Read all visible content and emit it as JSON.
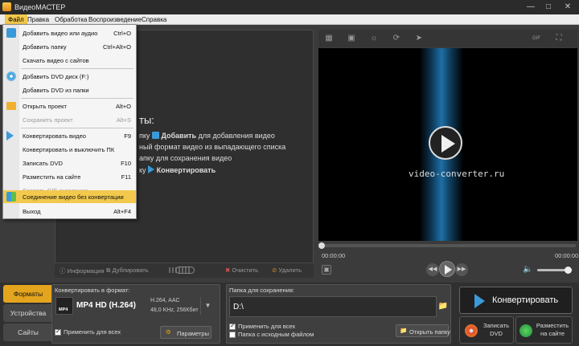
{
  "window": {
    "title": "ВидеоМАСТЕР"
  },
  "menubar": {
    "items": [
      "Файл",
      "Правка",
      "Обработка",
      "Воспроизведение",
      "Справка"
    ]
  },
  "file_menu": {
    "items": [
      {
        "label": "Добавить видео или аудио",
        "shortcut": "Ctrl+O",
        "icon": "add-video-icon"
      },
      {
        "label": "Добавить папку",
        "shortcut": "Ctrl+Alt+O"
      },
      {
        "label": "Скачать видео с сайтов",
        "shortcut": ""
      },
      {
        "label": "Добавить DVD диск (F:)",
        "shortcut": "",
        "icon": "dvd-icon"
      },
      {
        "label": "Добавить DVD из папки",
        "shortcut": ""
      },
      {
        "label": "Открыть проект",
        "shortcut": "Alt+O",
        "icon": "folder-icon"
      },
      {
        "label": "Сохранить проект",
        "shortcut": "Alt+S",
        "disabled": true
      },
      {
        "label": "Конвертировать видео",
        "shortcut": "F9",
        "icon": "play-icon"
      },
      {
        "label": "Конвертировать и выключить ПК",
        "shortcut": ""
      },
      {
        "label": "Записать DVD",
        "shortcut": "F10"
      },
      {
        "label": "Разместить на сайте",
        "shortcut": "F11"
      },
      {
        "label": "Создать GIF-анимацию",
        "shortcut": "",
        "disabled": true
      },
      {
        "label": "Соединение видео без конвертации",
        "shortcut": "",
        "icon": "join-icon",
        "highlighted": true
      },
      {
        "label": "Выход",
        "shortcut": "Alt+F4"
      }
    ]
  },
  "main_pane": {
    "heading_fragment": "ты:",
    "line1_pre": "пку",
    "line1_bold": "Добавить",
    "line1_post": "для добавления видео",
    "line2": "ный формат видео из выпадающего списка",
    "line3": "апку для сохранения видео",
    "line4_pre": "ку",
    "line4_bold": "Конвертировать"
  },
  "list_toolbar": {
    "info": "Информация",
    "duplicate": "Дублировать",
    "clear": "Очистить",
    "delete": "Удалить"
  },
  "player": {
    "watermark": "video-converter.ru",
    "time_start": "00:00:00",
    "time_end": "00:00:00",
    "progress": 0.0,
    "volume": 0.85
  },
  "side_tabs": {
    "formats": "Форматы",
    "devices": "Устройства",
    "sites": "Сайты"
  },
  "format_panel": {
    "label": "Конвертировать в формат:",
    "format_name": "MP4 HD (H.264)",
    "format_badge": "MP4",
    "codec": "H.264, AAC",
    "audio": "48,0 KHz, 256Кбит",
    "apply_all": "Применить для всех",
    "params_button": "Параметры"
  },
  "save_panel": {
    "label": "Папка для сохранения:",
    "path": "D:\\",
    "apply_all": "Применить для всех",
    "source_folder": "Папка с исходным файлом",
    "open_folder": "Открыть папку"
  },
  "actions": {
    "convert": "Конвертировать",
    "burn_dvd_line1": "Записать",
    "burn_dvd_line2": "DVD",
    "publish_line1": "Разместить",
    "publish_line2": "на сайте"
  },
  "colors": {
    "accent": "#f2c94c",
    "dark_bg": "#3b3b3b",
    "video_blue": "#1e6fa5"
  }
}
